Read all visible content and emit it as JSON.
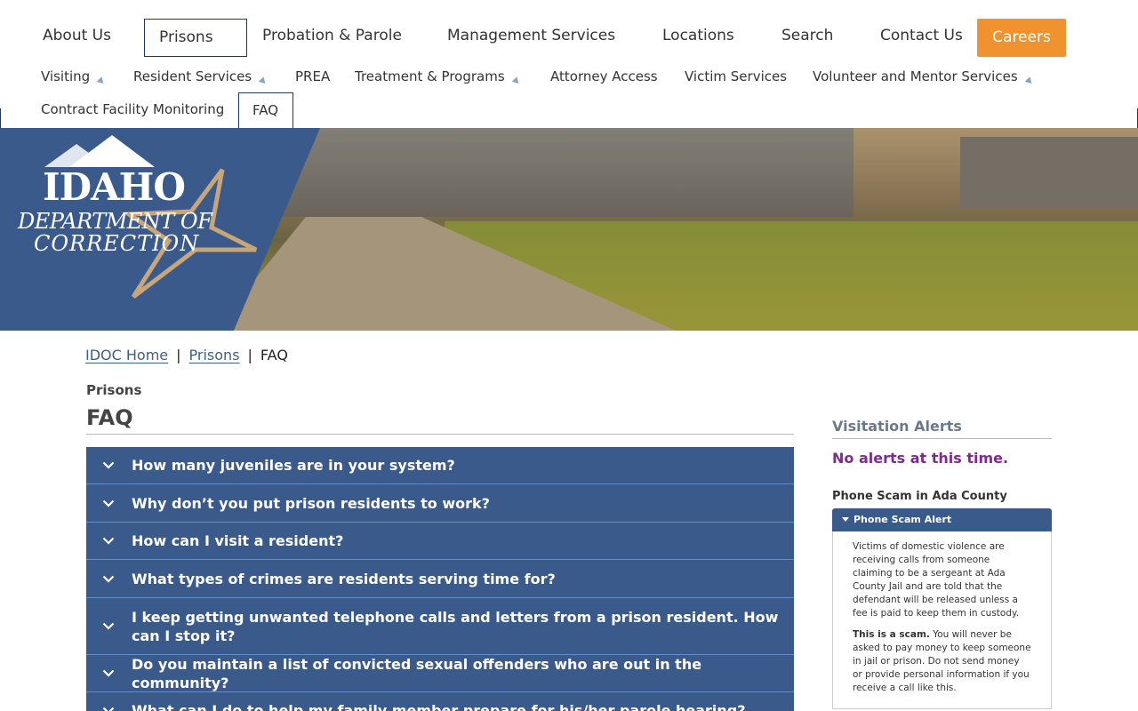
{
  "nav": {
    "main": [
      "About Us",
      "Prisons",
      "Probation & Parole",
      "Management Services",
      "Locations",
      "Search",
      "Contact Us"
    ],
    "careers": "Careers",
    "sub_row1": [
      "Visiting",
      "Resident Services",
      "PREA",
      "Treatment & Programs",
      "Attorney Access",
      "Victim Services",
      "Volunteer and Mentor Services"
    ],
    "sub_row2": [
      "Contract Facility Monitoring",
      "FAQ"
    ]
  },
  "logo": {
    "line1": "IDAHO",
    "line2": "DEPARTMENT OF",
    "line3": "CORRECTION"
  },
  "breadcrumb": {
    "home": "IDOC Home",
    "section": "Prisons",
    "current": "FAQ",
    "separator": "|"
  },
  "section_label": "Prisons",
  "page_title": "FAQ",
  "faq": [
    "How many juveniles are in your system?",
    "Why don’t you put prison residents to work?",
    "How can I visit a resident?",
    "What types of crimes are residents serving time for?",
    "I keep getting unwanted telephone calls and letters from a prison resident. How can I stop it?",
    "Do you maintain a list of convicted sexual offenders who are out in the community?",
    "What can I do to help my family member prepare for his/her parole hearing?"
  ],
  "sidebar": {
    "title": "Visitation Alerts",
    "alert": "No alerts at this time.",
    "subheading": "Phone Scam in Ada County",
    "scam_header": "Phone Scam Alert",
    "scam_p1": "Victims of domestic violence are receiving calls from someone claiming to be a sergeant at Ada County Jail and are told that the defendant will be released unless a fee is paid to keep them in custody.",
    "scam_bold": "This is a scam.",
    "scam_p2": " You will never be asked to pay money to keep someone in jail or prison. Do not send money or provide personal information if you receive a call like this."
  },
  "colors": {
    "navy": "#3a5a8c",
    "careers": "#f0922d",
    "alert": "#7e2b8e"
  }
}
